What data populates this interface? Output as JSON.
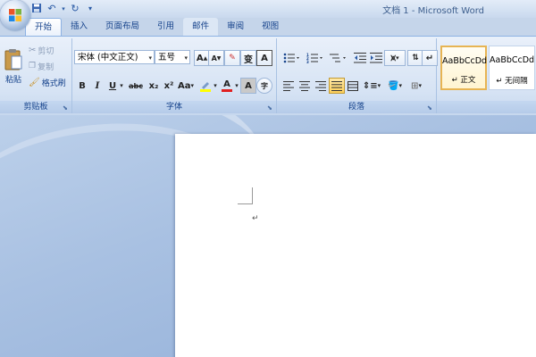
{
  "window": {
    "title": "文档 1 - Microsoft Word"
  },
  "qat": {
    "icons": [
      "save-icon",
      "undo-icon",
      "redo-icon",
      "customize-icon"
    ]
  },
  "tabs": [
    {
      "label": "开始",
      "active": true
    },
    {
      "label": "插入"
    },
    {
      "label": "页面布局"
    },
    {
      "label": "引用"
    },
    {
      "label": "邮件",
      "highlight": true
    },
    {
      "label": "审阅"
    },
    {
      "label": "视图"
    }
  ],
  "clipboard": {
    "label": "剪贴板",
    "paste": "粘贴",
    "cut": "剪切",
    "copy": "复制",
    "format_painter": "格式刷"
  },
  "font": {
    "label": "字体",
    "font_name": "宋体 (中文正文)",
    "font_size": "五号",
    "grow": "A",
    "shrink": "A",
    "bold": "B",
    "italic": "I",
    "underline": "U",
    "strike": "abc",
    "subscript": "x₂",
    "superscript": "x²",
    "change_case": "Aa",
    "font_color": "A",
    "char_shading": "A",
    "phonetic": "变",
    "char_border": "A",
    "enclose": "字"
  },
  "paragraph": {
    "label": "段落"
  },
  "styles": {
    "items": [
      {
        "sample": "AaBbCcDd",
        "name": "↵ 正文",
        "selected": true
      },
      {
        "sample": "AaBbCcDd",
        "name": "↵ 无间隔"
      }
    ]
  },
  "document": {
    "paragraph_mark": "↵"
  },
  "colors": {
    "accent": "#15428b",
    "highlight": "#ffd15a",
    "font_red": "#e02020",
    "highlight_yellow": "#ffff00"
  }
}
